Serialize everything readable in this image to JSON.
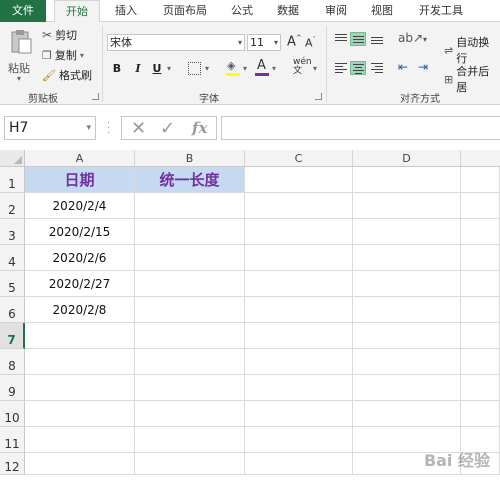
{
  "tabs": {
    "file": "文件",
    "home": "开始",
    "insert": "插入",
    "page_layout": "页面布局",
    "formulas": "公式",
    "data": "数据",
    "review": "审阅",
    "view": "视图",
    "developer": "开发工具"
  },
  "clipboard": {
    "paste": "粘贴",
    "cut": "剪切",
    "copy": "复制",
    "format_painter": "格式刷",
    "group_label": "剪贴板"
  },
  "font": {
    "font_name": "宋体",
    "font_size": "11",
    "bold": "B",
    "italic": "I",
    "underline": "U",
    "font_color_letter": "A",
    "group_label": "字体",
    "accent": "#7030a0"
  },
  "alignment": {
    "wrap_text": "自动换行",
    "merge_center": "合并后居",
    "group_label": "对齐方式"
  },
  "formula_bar": {
    "name_box": "H7",
    "fx": "fx",
    "formula": ""
  },
  "columns": [
    "A",
    "B",
    "C",
    "D"
  ],
  "rows": [
    "1",
    "2",
    "3",
    "4",
    "5",
    "6",
    "7",
    "8",
    "9",
    "10",
    "11",
    "12"
  ],
  "cells": {
    "a1": "日期",
    "b1": "统一长度",
    "a2": "2020/2/4",
    "a3": "2020/2/15",
    "a4": "2020/2/6",
    "a5": "2020/2/27",
    "a6": "2020/2/8"
  },
  "colors": {
    "excel_green": "#217346",
    "header_fill": "#c5d9f1",
    "header_text": "#7030a0"
  },
  "watermark": "Bai 经验"
}
